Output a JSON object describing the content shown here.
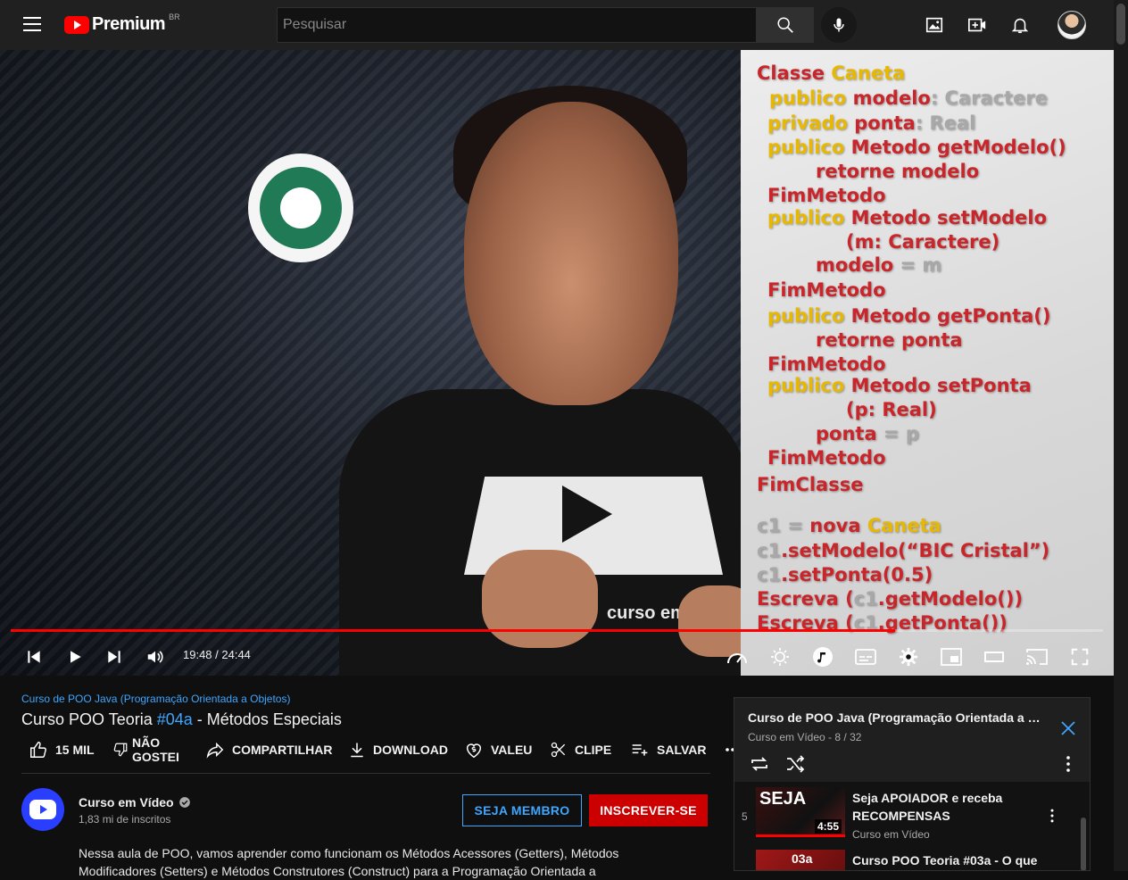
{
  "topbar": {
    "logo_text": "Premium",
    "country": "BR",
    "search_placeholder": "Pesquisar"
  },
  "player": {
    "time": "19:48 / 24:44",
    "progress": 0.81,
    "code_lines": [
      [
        [
          "Classe ",
          "red"
        ],
        [
          "Caneta",
          "yel"
        ]
      ],
      [
        [
          "publico ",
          "yel"
        ],
        [
          "modelo",
          "red"
        ],
        [
          ": Caractere",
          "gry"
        ]
      ],
      [
        [
          "privado ",
          "yel"
        ],
        [
          "ponta",
          "red"
        ],
        [
          ": Real",
          "gry"
        ]
      ],
      [
        [
          "publico ",
          "yel"
        ],
        [
          "Metodo ",
          "red"
        ],
        [
          "getModelo()",
          "red"
        ]
      ],
      [
        [
          "retorne ",
          "red"
        ],
        [
          "modelo",
          "red"
        ]
      ],
      [
        [
          "FimMetodo",
          "red"
        ]
      ],
      [
        [
          "publico ",
          "yel"
        ],
        [
          "Metodo ",
          "red"
        ],
        [
          "setModelo",
          "red"
        ]
      ],
      [
        [
          "(m: Caractere)",
          "red"
        ]
      ],
      [
        [
          "modelo",
          "red"
        ],
        [
          " = m",
          "gry"
        ]
      ],
      [
        [
          "FimMetodo",
          "red"
        ]
      ],
      [
        [
          "publico ",
          "yel"
        ],
        [
          "Metodo ",
          "red"
        ],
        [
          "getPonta()",
          "red"
        ]
      ],
      [
        [
          "retorne ",
          "red"
        ],
        [
          "ponta",
          "red"
        ]
      ],
      [
        [
          "FimMetodo",
          "red"
        ]
      ],
      [
        [
          "publico ",
          "yel"
        ],
        [
          "Metodo ",
          "red"
        ],
        [
          "setPonta",
          "red"
        ]
      ],
      [
        [
          "(p: Real)",
          "red"
        ]
      ],
      [
        [
          "ponta",
          "red"
        ],
        [
          " = p",
          "gry"
        ]
      ],
      [
        [
          "FimMetodo",
          "red"
        ]
      ],
      [
        [
          "FimClasse",
          "red"
        ]
      ],
      [
        [
          "c1",
          "gry"
        ],
        [
          " = ",
          "gry"
        ],
        [
          "nova ",
          "red"
        ],
        [
          "Caneta",
          "yel"
        ]
      ],
      [
        [
          "c1",
          "gry"
        ],
        [
          ".setModelo(“BIC Cristal”)",
          "red"
        ]
      ],
      [
        [
          "c1",
          "gry"
        ],
        [
          ".setPonta(0.5)",
          "red"
        ]
      ],
      [
        [
          "Escreva (",
          "red"
        ],
        [
          "c1",
          "gry"
        ],
        [
          ".getModelo())",
          "red"
        ]
      ],
      [
        [
          "Escreva (",
          "red"
        ],
        [
          "c1",
          "gry"
        ],
        [
          ".getPonta())",
          "red"
        ]
      ]
    ],
    "shirt_text": "curso em"
  },
  "video": {
    "playlist_link": "Curso de POO Java (Programação Orientada a Objetos)",
    "title_prefix": "Curso POO Teoria ",
    "title_tag": "#04a",
    "title_suffix": " - Métodos Especiais"
  },
  "actions": {
    "like": "15 MIL",
    "dislike_line1": "NÃO",
    "dislike_line2": "GOSTEI",
    "share": "COMPARTILHAR",
    "download": "DOWNLOAD",
    "thanks": "VALEU",
    "clip": "CLIPE",
    "save": "SALVAR"
  },
  "channel": {
    "name": "Curso em Vídeo",
    "subscribers": "1,83 mi de inscritos",
    "member_button": "SEJA MEMBRO",
    "subscribe_button": "INSCREVER-SE",
    "description": "Nessa aula de POO, vamos aprender como funcionam os Métodos Acessores (Getters), Métodos Modificadores (Setters) e Métodos Construtores (Construct) para a Programação Orientada a"
  },
  "playlist": {
    "title": "Curso de POO Java (Programação Orientada a Obj...",
    "channel": "Curso em Vídeo",
    "position": "8 / 32",
    "items": [
      {
        "num": "5",
        "title": "Seja APOIADOR e receba RECOMPENSAS",
        "channel": "Curso em Vídeo",
        "duration": "4:55",
        "thumb_text": "SEJA"
      },
      {
        "num": "",
        "title": "Curso POO Teoria #03a - O que",
        "channel": "",
        "duration": "",
        "thumb_text": "03a"
      }
    ]
  },
  "colors": {
    "accent_blue": "#3ea6ff",
    "subscribe_red": "#cc0000",
    "progress_red": "#ff0000",
    "code_red": "#c8262b",
    "code_yellow": "#e8b800"
  }
}
